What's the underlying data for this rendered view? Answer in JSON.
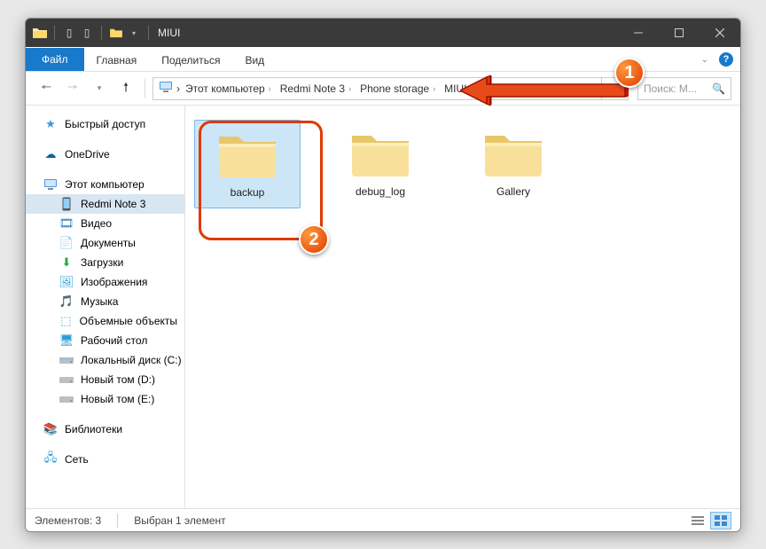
{
  "window": {
    "title": "MIUI"
  },
  "ribbon": {
    "file": "Файл",
    "tabs": [
      "Главная",
      "Поделиться",
      "Вид"
    ]
  },
  "breadcrumbs": [
    {
      "label": "Этот компьютер"
    },
    {
      "label": "Redmi Note 3"
    },
    {
      "label": "Phone storage"
    },
    {
      "label": "MIUI"
    }
  ],
  "search": {
    "placeholder": "Поиск: M..."
  },
  "sidebar": {
    "quick_access": "Быстрый доступ",
    "onedrive": "OneDrive",
    "this_pc": "Этот компьютер",
    "items": [
      {
        "label": "Redmi Note 3",
        "selected": true
      },
      {
        "label": "Видео"
      },
      {
        "label": "Документы"
      },
      {
        "label": "Загрузки"
      },
      {
        "label": "Изображения"
      },
      {
        "label": "Музыка"
      },
      {
        "label": "Объемные объекты"
      },
      {
        "label": "Рабочий стол"
      },
      {
        "label": "Локальный диск (C:)"
      },
      {
        "label": "Новый том (D:)"
      },
      {
        "label": "Новый том (E:)"
      }
    ],
    "libraries": "Библиотеки",
    "network": "Сеть"
  },
  "folders": [
    {
      "name": "backup",
      "selected": true
    },
    {
      "name": "debug_log",
      "selected": false
    },
    {
      "name": "Gallery",
      "selected": false
    }
  ],
  "status": {
    "count_label": "Элементов: 3",
    "selection_label": "Выбран 1 элемент"
  },
  "annotations": {
    "callout1": "1",
    "callout2": "2"
  }
}
